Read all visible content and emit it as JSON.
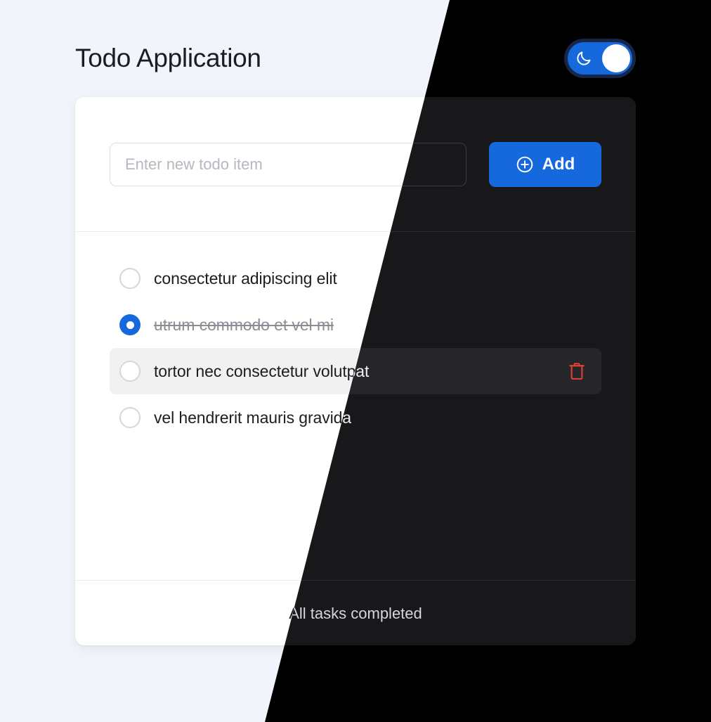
{
  "header": {
    "title": "Todo Application",
    "theme_toggle": {
      "name": "dark-mode-toggle",
      "state": "on",
      "icon": "moon-icon",
      "track_color": "#1668dd",
      "border_color": "#16254a",
      "knob_color": "#ffffff"
    }
  },
  "compose": {
    "input_value": "",
    "input_placeholder": "Enter new todo item",
    "add_label": "Add",
    "add_icon": "plus-circle-icon",
    "add_color": "#1668dd"
  },
  "todos": [
    {
      "label": "consectetur adipiscing elit",
      "completed": false,
      "hovered": false
    },
    {
      "label": "utrum commodo et vel mi",
      "completed": true,
      "hovered": false
    },
    {
      "label": "tortor nec consectetur volutpat",
      "completed": false,
      "hovered": true,
      "delete_icon": "trash-icon",
      "delete_color": "#e8412f"
    },
    {
      "label": "vel hendrerit mauris gravida",
      "completed": false,
      "hovered": false
    }
  ],
  "footer": {
    "status": "All tasks completed"
  },
  "theme": {
    "light_background": "#f1f4fb",
    "light_card": "#ffffff",
    "dark_background": "#000000",
    "dark_card": "#18181b",
    "accent": "#1668dd"
  }
}
